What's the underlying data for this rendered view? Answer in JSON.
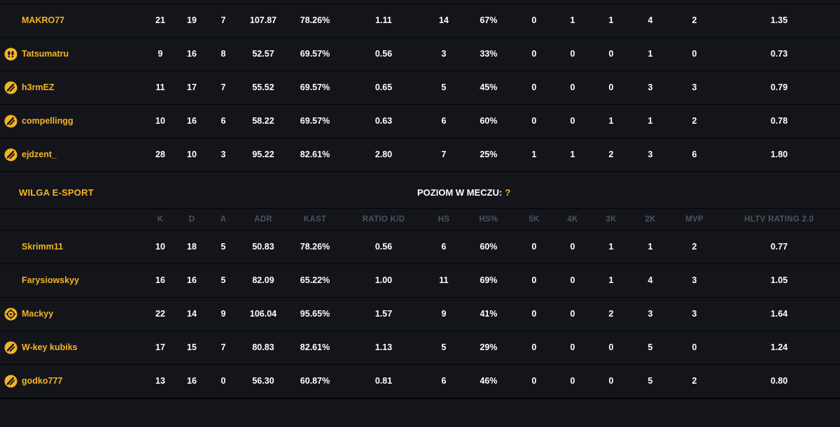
{
  "colors": {
    "accent": "#f5b324",
    "background": "#13151b",
    "header_text": "#4d525e"
  },
  "team_top": {
    "players": [
      {
        "name": "MAKRO77",
        "icon": "",
        "stats": [
          "21",
          "19",
          "7",
          "107.87",
          "78.26%",
          "1.11",
          "14",
          "67%",
          "0",
          "1",
          "1",
          "4",
          "2",
          "1.35"
        ]
      },
      {
        "name": "Tatsumatru",
        "icon": "footprint-icon",
        "stats": [
          "9",
          "16",
          "8",
          "52.57",
          "69.57%",
          "0.56",
          "3",
          "33%",
          "0",
          "0",
          "0",
          "1",
          "0",
          "0.73"
        ]
      },
      {
        "name": "h3rmEZ",
        "icon": "slash-badge-icon",
        "stats": [
          "11",
          "17",
          "7",
          "55.52",
          "69.57%",
          "0.65",
          "5",
          "45%",
          "0",
          "0",
          "0",
          "3",
          "3",
          "0.79"
        ]
      },
      {
        "name": "compellingg",
        "icon": "slash-badge-icon",
        "stats": [
          "10",
          "16",
          "6",
          "58.22",
          "69.57%",
          "0.63",
          "6",
          "60%",
          "0",
          "0",
          "1",
          "1",
          "2",
          "0.78"
        ]
      },
      {
        "name": "ejdzent_",
        "icon": "slash-badge-icon",
        "stats": [
          "28",
          "10",
          "3",
          "95.22",
          "82.61%",
          "2.80",
          "7",
          "25%",
          "1",
          "1",
          "2",
          "3",
          "6",
          "1.80"
        ]
      }
    ]
  },
  "team_bottom": {
    "name": "WILGA E-SPORT",
    "level_label": "POZIOM W MECZU:",
    "level_value": "?",
    "columns": [
      "K",
      "D",
      "A",
      "ADR",
      "KAST",
      "RATIO K/D",
      "HS",
      "HS%",
      "5K",
      "4K",
      "3K",
      "2K",
      "MVP",
      "HLTV RATING 2.0"
    ],
    "players": [
      {
        "name": "Skrimm11",
        "icon": "",
        "stats": [
          "10",
          "18",
          "5",
          "50.83",
          "78.26%",
          "0.56",
          "6",
          "60%",
          "0",
          "0",
          "1",
          "1",
          "2",
          "0.77"
        ]
      },
      {
        "name": "Farysiowskyy",
        "icon": "",
        "stats": [
          "16",
          "16",
          "5",
          "82.09",
          "65.22%",
          "1.00",
          "11",
          "69%",
          "0",
          "0",
          "1",
          "4",
          "3",
          "1.05"
        ]
      },
      {
        "name": "Mackyy",
        "icon": "crosshair-badge-icon",
        "stats": [
          "22",
          "14",
          "9",
          "106.04",
          "95.65%",
          "1.57",
          "9",
          "41%",
          "0",
          "0",
          "2",
          "3",
          "3",
          "1.64"
        ]
      },
      {
        "name": "W-key kubiks",
        "icon": "slash-badge-icon",
        "stats": [
          "17",
          "15",
          "7",
          "80.83",
          "82.61%",
          "1.13",
          "5",
          "29%",
          "0",
          "0",
          "0",
          "5",
          "0",
          "1.24"
        ]
      },
      {
        "name": "godko777",
        "icon": "slash-badge-icon",
        "stats": [
          "13",
          "16",
          "0",
          "56.30",
          "60.87%",
          "0.81",
          "6",
          "46%",
          "0",
          "0",
          "0",
          "5",
          "2",
          "0.80"
        ]
      }
    ]
  }
}
